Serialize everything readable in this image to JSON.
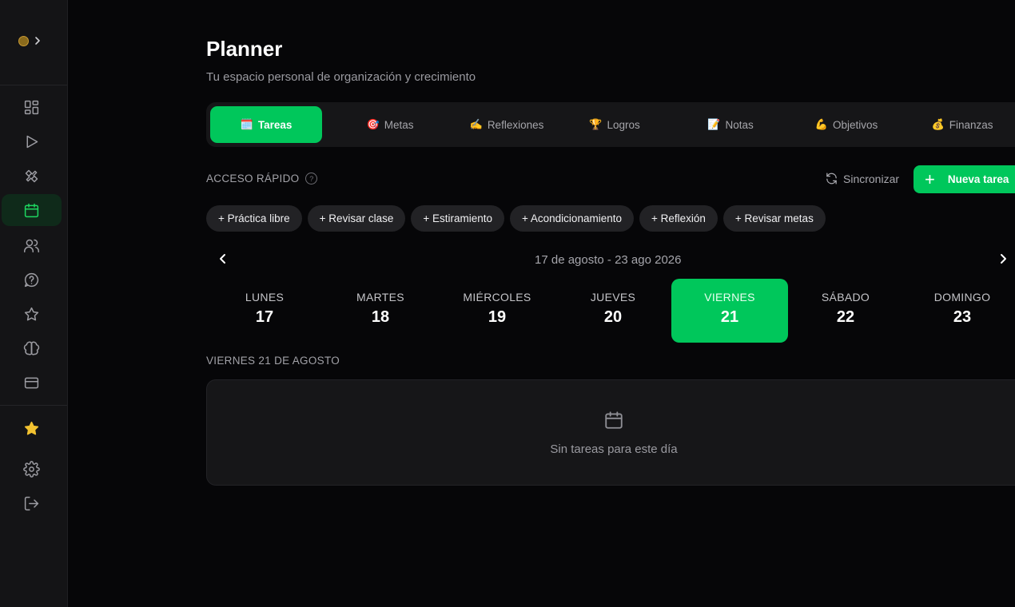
{
  "header": {
    "title": "Planner",
    "subtitle": "Tu espacio personal de organización y crecimiento"
  },
  "tabs": [
    {
      "label": "Tareas",
      "icon": "🗓️",
      "active": true
    },
    {
      "label": "Metas",
      "icon": "🎯",
      "active": false
    },
    {
      "label": "Reflexiones",
      "icon": "✍️",
      "active": false
    },
    {
      "label": "Logros",
      "icon": "🏆",
      "active": false
    },
    {
      "label": "Notas",
      "icon": "📝",
      "active": false
    },
    {
      "label": "Objetivos",
      "icon": "💪",
      "active": false
    },
    {
      "label": "Finanzas",
      "icon": "💰",
      "active": false
    }
  ],
  "quick_access": {
    "label": "ACCESO RÁPIDO",
    "help_icon": "?",
    "chips": [
      "+ Práctica libre",
      "+ Revisar clase",
      "+ Estiramiento",
      "+ Acondicionamiento",
      "+ Reflexión",
      "+ Revisar metas"
    ]
  },
  "actions": {
    "sync_label": "Sincronizar",
    "new_task_label": "Nueva tarea",
    "new_task_icon": "+"
  },
  "week": {
    "range": "17 de agosto - 23 ago 2026",
    "days": [
      {
        "name": "LUNES",
        "num": "17"
      },
      {
        "name": "MARTES",
        "num": "18"
      },
      {
        "name": "MIÉRCOLES",
        "num": "19"
      },
      {
        "name": "JUEVES",
        "num": "20"
      },
      {
        "name": "VIERNES",
        "num": "21",
        "active": true
      },
      {
        "name": "SÁBADO",
        "num": "22"
      },
      {
        "name": "DOMINGO",
        "num": "23"
      }
    ]
  },
  "selected_day": {
    "heading": "VIERNES 21 DE AGOSTO",
    "empty_text": "Sin tareas para este día"
  },
  "colors": {
    "accent": "#00c75b",
    "background": "#060608",
    "sidebar": "#141416",
    "favorite": "#f2c230"
  }
}
